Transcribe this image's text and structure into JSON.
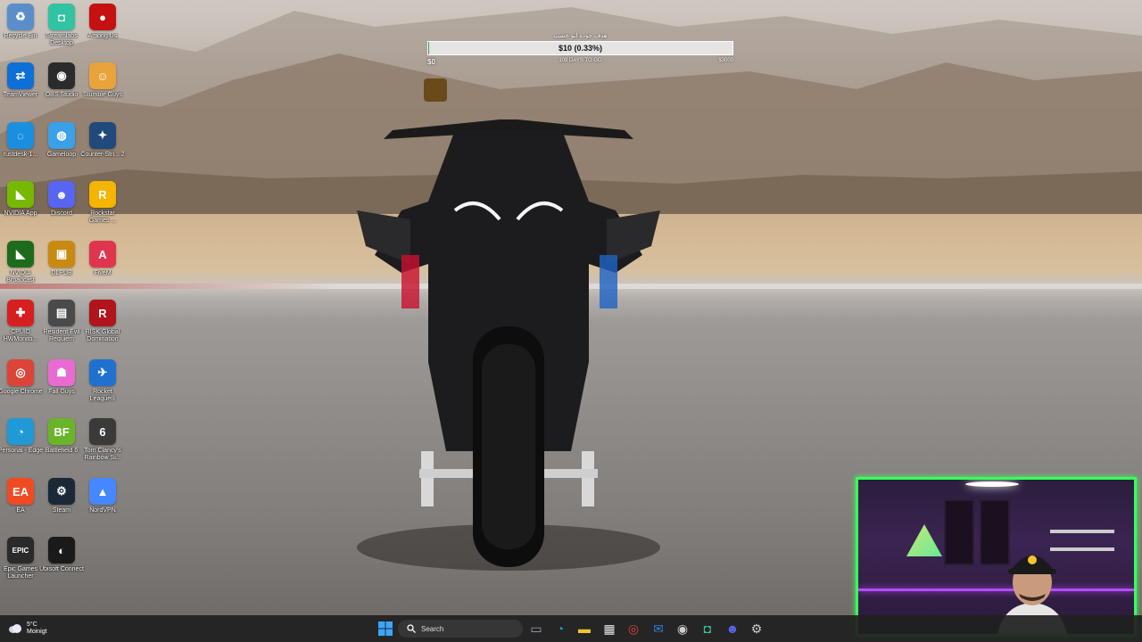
{
  "desktop": {
    "icons": [
      {
        "label": "Recycle Bin",
        "glyph": "♻",
        "color": "#5b8ec9",
        "name": "recycle-bin-icon"
      },
      {
        "label": "Streamlabs Desktop",
        "glyph": "◘",
        "color": "#31c3a2",
        "name": "streamlabs-icon"
      },
      {
        "label": "Among Us",
        "glyph": "●",
        "color": "#c51111",
        "name": "among-us-icon"
      },
      {
        "label": "TeamViewer",
        "glyph": "⇄",
        "color": "#0e6fd6",
        "name": "teamviewer-icon"
      },
      {
        "label": "OBS Studio",
        "glyph": "◉",
        "color": "#2b2b2b",
        "name": "obs-studio-icon"
      },
      {
        "label": "Stumble Guys",
        "glyph": "☺",
        "color": "#e8a33a",
        "name": "stumble-guys-icon"
      },
      {
        "label": "rustdesk-1...",
        "glyph": "◌",
        "color": "#1a8fe0",
        "name": "rustdesk-icon"
      },
      {
        "label": "Gameloop",
        "glyph": "◍",
        "color": "#3aa0e8",
        "name": "gameloop-icon"
      },
      {
        "label": "Counter-Stri... 2",
        "glyph": "✦",
        "color": "#1f4a7a",
        "name": "counter-strike-icon"
      },
      {
        "label": "NVIDIA App",
        "glyph": "◣",
        "color": "#76b900",
        "name": "nvidia-app-icon"
      },
      {
        "label": "Discord",
        "glyph": "☻",
        "color": "#5865f2",
        "name": "discord-icon"
      },
      {
        "label": "Rockstar Games ...",
        "glyph": "R",
        "color": "#f5b400",
        "name": "rockstar-games-icon"
      },
      {
        "label": "NVIDIA Broadcast",
        "glyph": "◣",
        "color": "#1e6b1e",
        "name": "nvidia-broadcast-icon"
      },
      {
        "label": "DLPUB",
        "glyph": "▣",
        "color": "#c98a12",
        "name": "dlpub-icon"
      },
      {
        "label": "FiveM",
        "glyph": "A",
        "color": "#e0364d",
        "name": "fivem-icon"
      },
      {
        "label": "CPUID HWMonito...",
        "glyph": "✚",
        "color": "#d62020",
        "name": "hwmonitor-icon"
      },
      {
        "label": "Resident Evil Requiem",
        "glyph": "▤",
        "color": "#4a4a4a",
        "name": "resident-evil-icon"
      },
      {
        "label": "RISK Global Domination",
        "glyph": "R",
        "color": "#b0141c",
        "name": "risk-icon"
      },
      {
        "label": "Google Chrome",
        "glyph": "◎",
        "color": "#db4437",
        "name": "chrome-icon"
      },
      {
        "label": "Fall Guys",
        "glyph": "☗",
        "color": "#e86bd1",
        "name": "fall-guys-icon"
      },
      {
        "label": "Rocket League®",
        "glyph": "✈",
        "color": "#2070d0",
        "name": "rocket-league-icon"
      },
      {
        "label": "Personal - Edge",
        "glyph": "◔",
        "color": "#1f9ad6",
        "name": "edge-icon"
      },
      {
        "label": "Battlefield 6",
        "glyph": "BF",
        "color": "#6ab42a",
        "name": "battlefield-icon"
      },
      {
        "label": "Tom Clancy's Rainbow Si...",
        "glyph": "6",
        "color": "#3a3a3a",
        "name": "rainbow-six-icon"
      },
      {
        "label": "EA",
        "glyph": "EA",
        "color": "#ef4b23",
        "name": "ea-icon"
      },
      {
        "label": "Steam",
        "glyph": "⚙",
        "color": "#1b2838",
        "name": "steam-icon"
      },
      {
        "label": "NordVPN",
        "glyph": "▲",
        "color": "#4687ff",
        "name": "nordvpn-icon"
      },
      {
        "label": "Epic Games Launcher",
        "glyph": "EPIC",
        "color": "#2a2a2a",
        "name": "epic-games-icon"
      },
      {
        "label": "Ubisoft Connect",
        "glyph": "◐",
        "color": "#1a1a1a",
        "name": "ubisoft-connect-icon"
      }
    ]
  },
  "goal": {
    "caption": "هدف جودة ابو خشب",
    "amount": "$10 (0.33%)",
    "progress_percent": 0.33,
    "start_label": "$0",
    "days_label": "109 DAYS TO GO",
    "end_label": "$3000",
    "fill_color": "#2f9e44"
  },
  "taskbar": {
    "weather": {
      "temp": "5°C",
      "condition": "Moinigt"
    },
    "search_label": "Search",
    "apps": [
      {
        "name": "task-view-icon"
      },
      {
        "name": "edge-taskbar-icon"
      },
      {
        "name": "file-explorer-icon"
      },
      {
        "name": "store-icon"
      },
      {
        "name": "chrome-taskbar-icon"
      },
      {
        "name": "mail-icon"
      },
      {
        "name": "obs-taskbar-icon"
      },
      {
        "name": "streamlabs-taskbar-icon"
      },
      {
        "name": "discord-taskbar-icon"
      },
      {
        "name": "settings-icon"
      }
    ]
  },
  "accent_colors": {
    "webcam_border": "#39ff5a",
    "taskbar": "#202020"
  }
}
